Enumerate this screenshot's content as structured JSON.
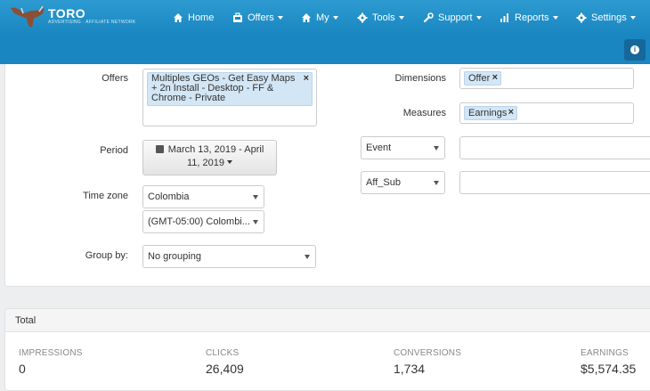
{
  "brand": {
    "name": "TORO",
    "tagline": "ADVERTISING · AFFILIATE NETWORK"
  },
  "nav": [
    {
      "label": "Home",
      "icon": "home-icon"
    },
    {
      "label": "Offers",
      "icon": "briefcase-icon"
    },
    {
      "label": "My",
      "icon": "home-icon"
    },
    {
      "label": "Tools",
      "icon": "gear-icon"
    },
    {
      "label": "Support",
      "icon": "wrench-icon"
    },
    {
      "label": "Reports",
      "icon": "bar-chart-icon"
    },
    {
      "label": "Settings",
      "icon": "gear-icon"
    }
  ],
  "info_button": {
    "glyph": "i"
  },
  "filters": {
    "offers_label": "Offers",
    "offers_tag": "Multiples GEOs - Get Easy Maps + 2n Install - Desktop - FF & Chrome - Private",
    "period_label": "Period",
    "period_value_line1": "March 13, 2019 - April",
    "period_value_line2": "11, 2019",
    "timezone_label": "Time zone",
    "timezone_region": "Colombia",
    "timezone_offset": "(GMT-05:00) Colombi...",
    "groupby_label": "Group by:",
    "groupby_value": "No grouping",
    "dimensions_label": "Dimensions",
    "dimensions_tag": "Offer",
    "measures_label": "Measures",
    "measures_tag": "Earnings",
    "event_select": "Event",
    "affsub_select": "Aff_Sub"
  },
  "total": {
    "title": "Total",
    "stats": [
      {
        "label": "IMPRESSIONS",
        "value": "0"
      },
      {
        "label": "CLICKS",
        "value": "26,409"
      },
      {
        "label": "CONVERSIONS",
        "value": "1,734"
      },
      {
        "label": "EARNINGS",
        "value": "$5,574.35"
      }
    ]
  },
  "colors": {
    "header": "#1a86c1",
    "tag_bg": "#d3e6f5",
    "info_button": "#16679a"
  }
}
